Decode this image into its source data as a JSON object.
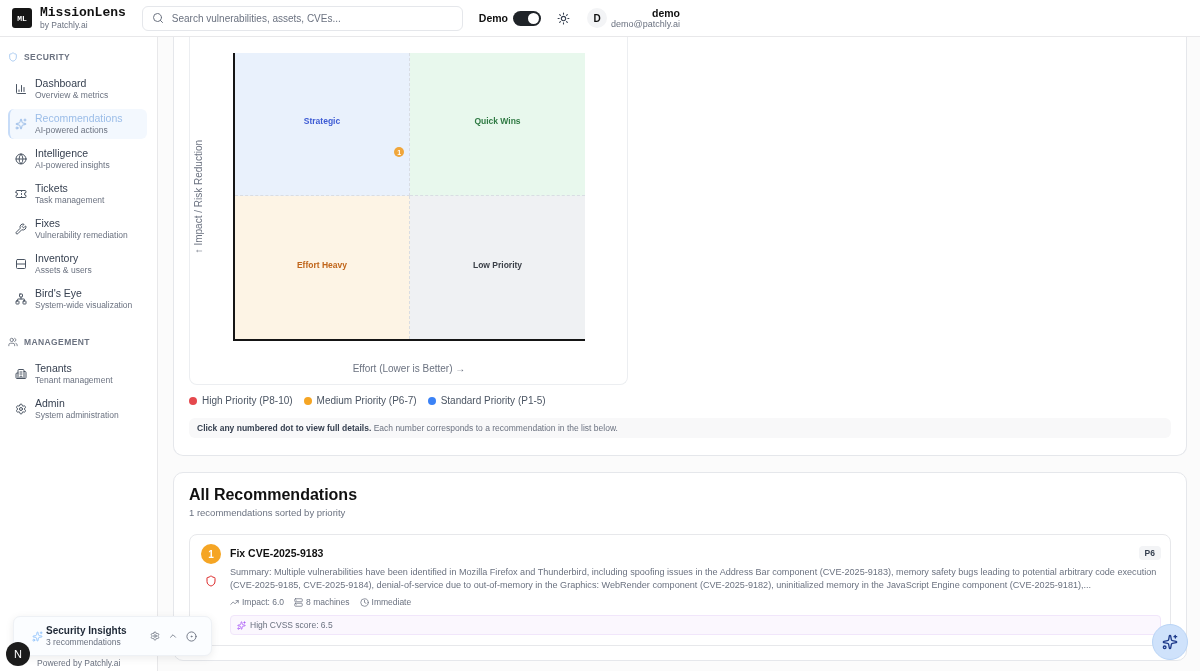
{
  "header": {
    "logo_mark": "ML",
    "app_name": "MissionLens",
    "byline": "by Patchly.ai",
    "search": {
      "placeholder": "Search vulnerabilities, assets, CVEs..."
    },
    "demo_toggle": {
      "label": "Demo",
      "on": true
    },
    "user": {
      "avatar": "D",
      "name": "demo",
      "email": "demo@patchly.ai"
    }
  },
  "sidebar": {
    "sections": [
      {
        "title": "SECURITY",
        "items": [
          {
            "title": "Dashboard",
            "subtitle": "Overview & metrics",
            "selected": false
          },
          {
            "title": "Recommendations",
            "subtitle": "AI-powered actions",
            "selected": true
          },
          {
            "title": "Intelligence",
            "subtitle": "AI-powered insights",
            "selected": false
          },
          {
            "title": "Tickets",
            "subtitle": "Task management",
            "selected": false
          },
          {
            "title": "Fixes",
            "subtitle": "Vulnerability remediation",
            "selected": false
          },
          {
            "title": "Inventory",
            "subtitle": "Assets & users",
            "selected": false
          },
          {
            "title": "Bird's Eye",
            "subtitle": "System-wide visualization",
            "selected": false
          }
        ]
      },
      {
        "title": "MANAGEMENT",
        "items": [
          {
            "title": "Tenants",
            "subtitle": "Tenant management",
            "selected": false
          },
          {
            "title": "Admin",
            "subtitle": "System administration",
            "selected": false
          }
        ]
      }
    ],
    "footer": "Powered by Patchly.ai"
  },
  "matrix": {
    "y_label": "↑ Impact / Risk Reduction",
    "x_label": "Effort (Lower is Better) →",
    "quadrants": [
      {
        "label": "Strategic"
      },
      {
        "label": "Quick Wins"
      },
      {
        "label": "Effort Heavy"
      },
      {
        "label": "Low Priority"
      }
    ],
    "points": [
      {
        "label": "1",
        "color": "#f0a63a"
      }
    ],
    "legend": [
      {
        "label": "High Priority (P8-10)",
        "color": "#e5484d"
      },
      {
        "label": "Medium Priority (P6-7)",
        "color": "#f5a524"
      },
      {
        "label": "Standard Priority (P1-5)",
        "color": "#3b82f6"
      }
    ],
    "note": "**Click any numbered dot to view full details.** Each number corresponds to a recommendation in the list below."
  },
  "recommendations": {
    "title": "All Recommendations",
    "subtitle": "1 recommendations sorted by priority",
    "items": [
      {
        "number": "1",
        "color": "#f5a524",
        "title": "Fix CVE-2025-9183",
        "priority": "P6",
        "summary": "Summary: Multiple vulnerabilities have been identified in Mozilla Firefox and Thunderbird, including spoofing issues in the Address Bar component (CVE-2025-9183), memory safety bugs leading to potential arbitrary code execution (CVE-2025-9185, CVE-2025-9184), denial-of-service due to out-of-memory in the Graphics: WebRender component (CVE-2025-9182), uninitialized memory in the JavaScript Engine component (CVE-2025-9181),...",
        "meta": [
          "Impact: 6.0",
          "8 machines",
          "Immediate"
        ],
        "highlights": [
          "High CVSS score: 6.5"
        ]
      }
    ]
  },
  "insights_panel": {
    "title": "Security Insights",
    "subtitle": "3 recommendations"
  },
  "dev_badge": "N"
}
